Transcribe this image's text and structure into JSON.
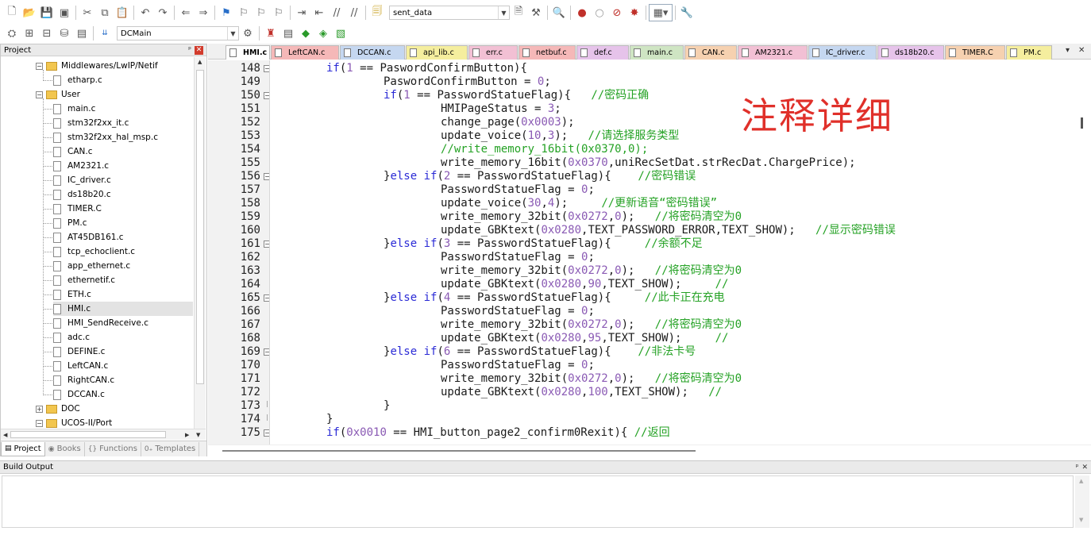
{
  "toolbar": {
    "target_combo": "sent_data",
    "project_combo": "DCMain"
  },
  "project_panel": {
    "title": "Project",
    "tree": [
      {
        "label": "Middlewares/LwIP/Netif",
        "type": "folder",
        "level": 1,
        "expanded": true
      },
      {
        "label": "etharp.c",
        "type": "file",
        "level": 2
      },
      {
        "label": "User",
        "type": "folder",
        "level": 1,
        "expanded": true
      },
      {
        "label": "main.c",
        "type": "file",
        "level": 2
      },
      {
        "label": "stm32f2xx_it.c",
        "type": "file",
        "level": 2
      },
      {
        "label": "stm32f2xx_hal_msp.c",
        "type": "file",
        "level": 2
      },
      {
        "label": "CAN.c",
        "type": "file",
        "level": 2
      },
      {
        "label": "AM2321.c",
        "type": "file",
        "level": 2
      },
      {
        "label": "IC_driver.c",
        "type": "file",
        "level": 2
      },
      {
        "label": "ds18b20.c",
        "type": "file",
        "level": 2
      },
      {
        "label": "TIMER.C",
        "type": "file",
        "level": 2
      },
      {
        "label": "PM.c",
        "type": "file",
        "level": 2
      },
      {
        "label": "AT45DB161.c",
        "type": "file",
        "level": 2
      },
      {
        "label": "tcp_echoclient.c",
        "type": "file",
        "level": 2
      },
      {
        "label": "app_ethernet.c",
        "type": "file",
        "level": 2
      },
      {
        "label": "ethernetif.c",
        "type": "file",
        "level": 2
      },
      {
        "label": "ETH.c",
        "type": "file",
        "level": 2
      },
      {
        "label": "HMI.c",
        "type": "file",
        "level": 2,
        "selected": true
      },
      {
        "label": "HMI_SendReceive.c",
        "type": "file",
        "level": 2
      },
      {
        "label": "adc.c",
        "type": "file",
        "level": 2
      },
      {
        "label": "DEFINE.c",
        "type": "file",
        "level": 2
      },
      {
        "label": "LeftCAN.c",
        "type": "file",
        "level": 2
      },
      {
        "label": "RightCAN.c",
        "type": "file",
        "level": 2
      },
      {
        "label": "DCCAN.c",
        "type": "file",
        "level": 2
      },
      {
        "label": "DOC",
        "type": "folder",
        "level": 1,
        "expanded": false
      },
      {
        "label": "UCOS-II/Port",
        "type": "folder",
        "level": 1,
        "expanded": true
      }
    ],
    "tabs": [
      "Project",
      "Books",
      "Functions",
      "Templates"
    ],
    "tab_icons": [
      "project-icon",
      "books-icon",
      "functions-icon",
      "templates-icon"
    ]
  },
  "editor": {
    "tabs": [
      {
        "label": "HMI.c",
        "color": "#ffffff",
        "active": true
      },
      {
        "label": "LeftCAN.c",
        "color": "#f5b8b8"
      },
      {
        "label": "DCCAN.c",
        "color": "#c5d7f0"
      },
      {
        "label": "api_lib.c",
        "color": "#f5ee9e"
      },
      {
        "label": "err.c",
        "color": "#f2c0d4"
      },
      {
        "label": "netbuf.c",
        "color": "#f5b8b8"
      },
      {
        "label": "def.c",
        "color": "#e6c3ea"
      },
      {
        "label": "main.c",
        "color": "#cfe5c3"
      },
      {
        "label": "CAN.c",
        "color": "#f6d1b0"
      },
      {
        "label": "AM2321.c",
        "color": "#f2c0d4"
      },
      {
        "label": "IC_driver.c",
        "color": "#c5d7f0"
      },
      {
        "label": "ds18b20.c",
        "color": "#e6c3ea"
      },
      {
        "label": "TIMER.C",
        "color": "#f6d1b0"
      },
      {
        "label": "PM.c",
        "color": "#f5ee9e"
      }
    ],
    "overlay_text": "注释详细",
    "lines": [
      {
        "n": "148",
        "fold": "minus",
        "indent": 2,
        "tokens": [
          [
            "kw",
            "if"
          ],
          [
            "p",
            "("
          ],
          [
            "num",
            "1"
          ],
          [
            "p",
            " == PaswordConfirmButton){"
          ]
        ]
      },
      {
        "n": "149",
        "indent": 3,
        "tokens": [
          [
            "p",
            "PaswordConfirmButton = "
          ],
          [
            "num",
            "0"
          ],
          [
            "p",
            ";"
          ]
        ]
      },
      {
        "n": "150",
        "fold": "minus",
        "indent": 3,
        "tokens": [
          [
            "kw",
            "if"
          ],
          [
            "p",
            "("
          ],
          [
            "num",
            "1"
          ],
          [
            "p",
            " == PasswordStatueFlag){   "
          ],
          [
            "cm",
            "//密码正确"
          ]
        ]
      },
      {
        "n": "151",
        "indent": 4,
        "tokens": [
          [
            "p",
            "HMIPageStatus = "
          ],
          [
            "num",
            "3"
          ],
          [
            "p",
            ";"
          ]
        ]
      },
      {
        "n": "152",
        "indent": 4,
        "tokens": [
          [
            "p",
            "change_page("
          ],
          [
            "num",
            "0x0003"
          ],
          [
            "p",
            ");"
          ]
        ]
      },
      {
        "n": "153",
        "indent": 4,
        "tokens": [
          [
            "p",
            "update_voice("
          ],
          [
            "num",
            "10"
          ],
          [
            "p",
            ","
          ],
          [
            "num",
            "3"
          ],
          [
            "p",
            ");   "
          ],
          [
            "cm",
            "//请选择服务类型"
          ]
        ]
      },
      {
        "n": "154",
        "indent": 4,
        "tokens": [
          [
            "cm",
            "//write_memory_16bit(0x0370,0);"
          ]
        ]
      },
      {
        "n": "155",
        "indent": 4,
        "tokens": [
          [
            "p",
            "write_memory_16bit("
          ],
          [
            "num",
            "0x0370"
          ],
          [
            "p",
            ",uniRecSetDat.strRecDat.ChargePrice);"
          ]
        ]
      },
      {
        "n": "156",
        "fold": "minus",
        "indent": 3,
        "tokens": [
          [
            "p",
            "}"
          ],
          [
            "kw",
            "else if"
          ],
          [
            "p",
            "("
          ],
          [
            "num",
            "2"
          ],
          [
            "p",
            " == PasswordStatueFlag){    "
          ],
          [
            "cm",
            "//密码错误"
          ]
        ]
      },
      {
        "n": "157",
        "indent": 4,
        "tokens": [
          [
            "p",
            "PasswordStatueFlag = "
          ],
          [
            "num",
            "0"
          ],
          [
            "p",
            ";"
          ]
        ]
      },
      {
        "n": "158",
        "indent": 4,
        "tokens": [
          [
            "p",
            "update_voice("
          ],
          [
            "num",
            "30"
          ],
          [
            "p",
            ","
          ],
          [
            "num",
            "4"
          ],
          [
            "p",
            ");     "
          ],
          [
            "cm",
            "//更新语音“密码错误”"
          ]
        ]
      },
      {
        "n": "159",
        "indent": 4,
        "tokens": [
          [
            "p",
            "write_memory_32bit("
          ],
          [
            "num",
            "0x0272"
          ],
          [
            "p",
            ","
          ],
          [
            "num",
            "0"
          ],
          [
            "p",
            ");   "
          ],
          [
            "cm",
            "//将密码清空为0"
          ]
        ]
      },
      {
        "n": "160",
        "indent": 4,
        "tokens": [
          [
            "p",
            "update_GBKtext("
          ],
          [
            "num",
            "0x0280"
          ],
          [
            "p",
            ",TEXT_PASSWORD_ERROR,TEXT_SHOW);   "
          ],
          [
            "cm",
            "//显示密码错误"
          ]
        ]
      },
      {
        "n": "161",
        "fold": "minus",
        "indent": 3,
        "tokens": [
          [
            "p",
            "}"
          ],
          [
            "kw",
            "else if"
          ],
          [
            "p",
            "("
          ],
          [
            "num",
            "3"
          ],
          [
            "p",
            " == PasswordStatueFlag){     "
          ],
          [
            "cm",
            "//余额不足"
          ]
        ]
      },
      {
        "n": "162",
        "indent": 4,
        "tokens": [
          [
            "p",
            "PasswordStatueFlag = "
          ],
          [
            "num",
            "0"
          ],
          [
            "p",
            ";"
          ]
        ]
      },
      {
        "n": "163",
        "indent": 4,
        "tokens": [
          [
            "p",
            "write_memory_32bit("
          ],
          [
            "num",
            "0x0272"
          ],
          [
            "p",
            ","
          ],
          [
            "num",
            "0"
          ],
          [
            "p",
            ");   "
          ],
          [
            "cm",
            "//将密码清空为0"
          ]
        ]
      },
      {
        "n": "164",
        "indent": 4,
        "tokens": [
          [
            "p",
            "update_GBKtext("
          ],
          [
            "num",
            "0x0280"
          ],
          [
            "p",
            ","
          ],
          [
            "num",
            "90"
          ],
          [
            "p",
            ",TEXT_SHOW);     "
          ],
          [
            "cm",
            "//"
          ]
        ]
      },
      {
        "n": "165",
        "fold": "minus",
        "indent": 3,
        "tokens": [
          [
            "p",
            "}"
          ],
          [
            "kw",
            "else if"
          ],
          [
            "p",
            "("
          ],
          [
            "num",
            "4"
          ],
          [
            "p",
            " == PasswordStatueFlag){     "
          ],
          [
            "cm",
            "//此卡正在充电"
          ]
        ]
      },
      {
        "n": "166",
        "indent": 4,
        "tokens": [
          [
            "p",
            "PasswordStatueFlag = "
          ],
          [
            "num",
            "0"
          ],
          [
            "p",
            ";"
          ]
        ]
      },
      {
        "n": "167",
        "indent": 4,
        "tokens": [
          [
            "p",
            "write_memory_32bit("
          ],
          [
            "num",
            "0x0272"
          ],
          [
            "p",
            ","
          ],
          [
            "num",
            "0"
          ],
          [
            "p",
            ");   "
          ],
          [
            "cm",
            "//将密码清空为0"
          ]
        ]
      },
      {
        "n": "168",
        "indent": 4,
        "tokens": [
          [
            "p",
            "update_GBKtext("
          ],
          [
            "num",
            "0x0280"
          ],
          [
            "p",
            ","
          ],
          [
            "num",
            "95"
          ],
          [
            "p",
            ",TEXT_SHOW);     "
          ],
          [
            "cm",
            "//"
          ]
        ]
      },
      {
        "n": "169",
        "fold": "minus",
        "indent": 3,
        "tokens": [
          [
            "p",
            "}"
          ],
          [
            "kw",
            "else if"
          ],
          [
            "p",
            "("
          ],
          [
            "num",
            "6"
          ],
          [
            "p",
            " == PasswordStatueFlag){    "
          ],
          [
            "cm",
            "//非法卡号"
          ]
        ]
      },
      {
        "n": "170",
        "indent": 4,
        "tokens": [
          [
            "p",
            "PasswordStatueFlag = "
          ],
          [
            "num",
            "0"
          ],
          [
            "p",
            ";"
          ]
        ]
      },
      {
        "n": "171",
        "indent": 4,
        "tokens": [
          [
            "p",
            "write_memory_32bit("
          ],
          [
            "num",
            "0x0272"
          ],
          [
            "p",
            ","
          ],
          [
            "num",
            "0"
          ],
          [
            "p",
            ");   "
          ],
          [
            "cm",
            "//将密码清空为0"
          ]
        ]
      },
      {
        "n": "172",
        "indent": 4,
        "tokens": [
          [
            "p",
            "update_GBKtext("
          ],
          [
            "num",
            "0x0280"
          ],
          [
            "p",
            ","
          ],
          [
            "num",
            "100"
          ],
          [
            "p",
            ",TEXT_SHOW);   "
          ],
          [
            "cm",
            "//"
          ]
        ]
      },
      {
        "n": "173",
        "fold": "end",
        "indent": 3,
        "tokens": [
          [
            "p",
            "}"
          ]
        ]
      },
      {
        "n": "174",
        "fold": "end",
        "indent": 2,
        "tokens": [
          [
            "p",
            "}"
          ]
        ]
      },
      {
        "n": "175",
        "fold": "minus",
        "indent": 2,
        "tokens": [
          [
            "kw",
            "if"
          ],
          [
            "p",
            "("
          ],
          [
            "num",
            "0x0010"
          ],
          [
            "p",
            " == HMI_button_page2_confirm0Rexit){ "
          ],
          [
            "cm",
            "//返回"
          ]
        ]
      }
    ]
  },
  "build_output": {
    "title": "Build Output"
  }
}
